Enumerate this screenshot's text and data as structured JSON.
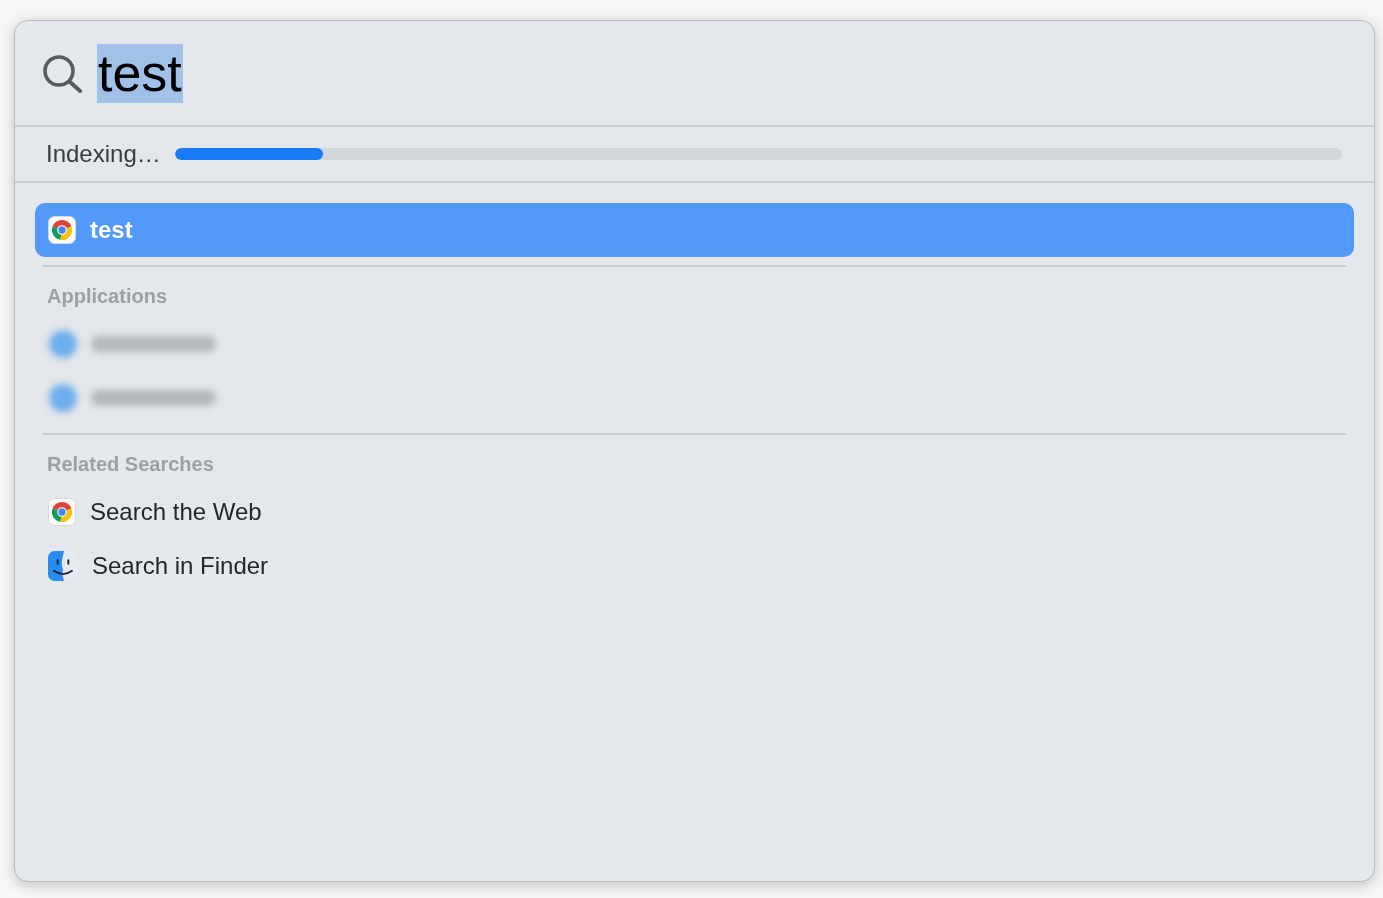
{
  "search": {
    "value": "test",
    "selected": true
  },
  "indexing": {
    "label": "Indexing…",
    "level": 0.127
  },
  "top_hit": {
    "label": "test",
    "kind": "web",
    "selected": true
  },
  "sections": [
    {
      "heading": "Applications",
      "items": [
        {
          "kind": "redacted"
        },
        {
          "kind": "redacted"
        }
      ]
    },
    {
      "heading": "Related Searches",
      "items": [
        {
          "kind": "web",
          "label": "Search the Web",
          "selected": false
        },
        {
          "kind": "finder",
          "label": "Search in Finder",
          "selected": false
        }
      ]
    }
  ]
}
